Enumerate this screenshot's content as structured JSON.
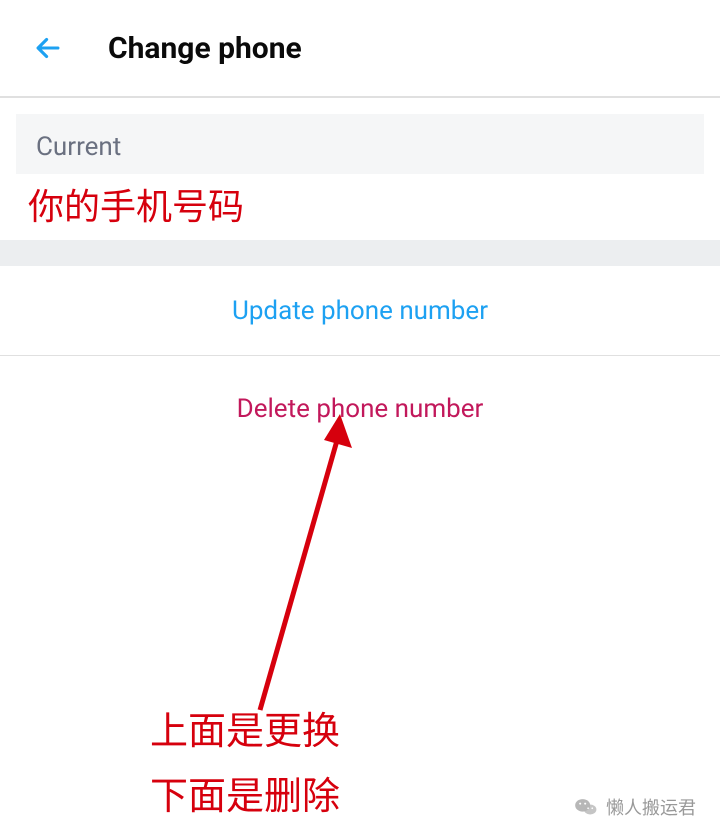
{
  "header": {
    "title": "Change phone"
  },
  "current": {
    "label": "Current",
    "phone_annotation": "你的手机号码"
  },
  "actions": {
    "update_label": "Update phone number",
    "delete_label": "Delete phone number"
  },
  "annotations": {
    "line1": "上面是更换",
    "line2": "下面是删除"
  },
  "watermark": {
    "text": "懒人搬运君"
  },
  "colors": {
    "accent_blue": "#1da1f2",
    "accent_red": "#c2185b",
    "annotation_red": "#d6000d"
  }
}
